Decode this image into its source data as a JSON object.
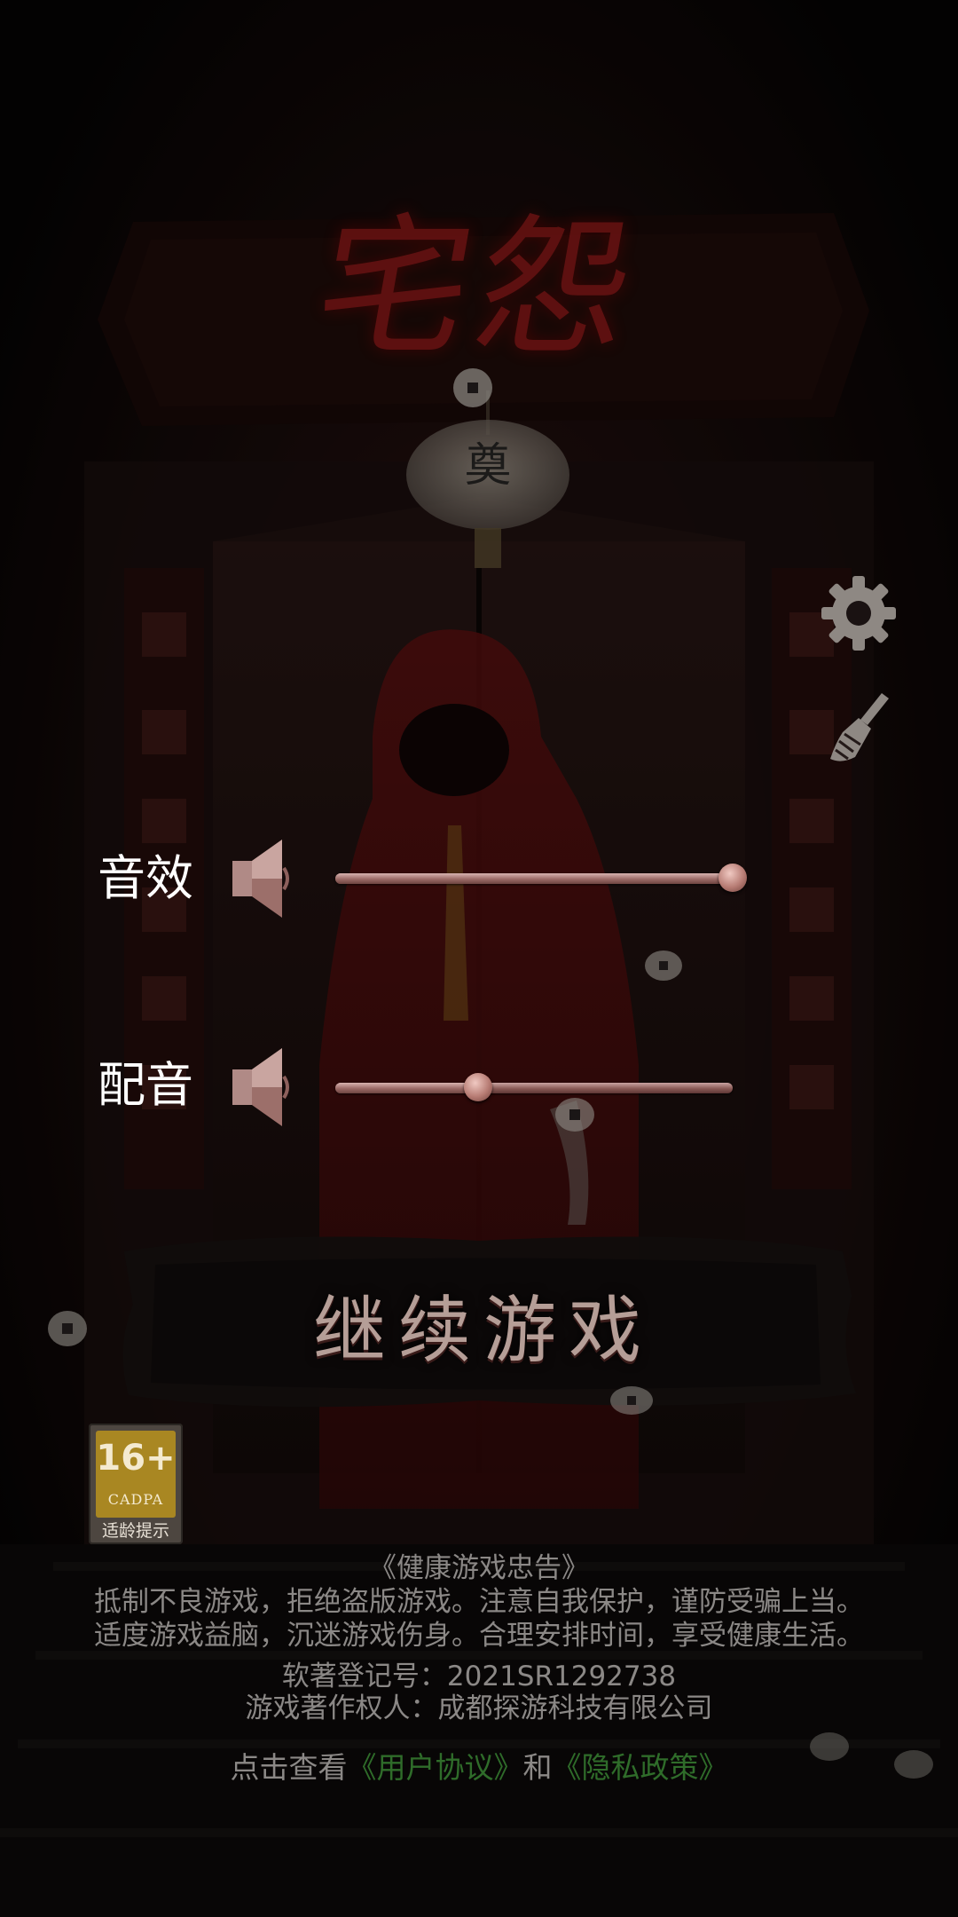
{
  "game": {
    "title_logo": "宅怨",
    "lantern_char": "奠"
  },
  "toolbar": {
    "settings_icon": "gear-icon",
    "clean_icon": "broom-icon"
  },
  "audio": {
    "sound_effects": {
      "label": "音效",
      "icon": "speaker-icon",
      "level_percent": 100
    },
    "voice": {
      "label": "配音",
      "icon": "speaker-icon",
      "level_percent": 36
    }
  },
  "continue_button": {
    "label": "继续游戏"
  },
  "age_rating": {
    "age": "16+",
    "org": "CADPA",
    "hint": "适龄提示",
    "color": "#a98722"
  },
  "health_notice": {
    "title": "《健康游戏忠告》",
    "line1": "抵制不良游戏，拒绝盗版游戏。注意自我保护，谨防受骗上当。",
    "line2": "适度游戏益脑，沉迷游戏伤身。合理安排时间，享受健康生活。"
  },
  "copyright": {
    "registration": "软著登记号：2021SR1292738",
    "owner": "游戏著作权人：成都探游科技有限公司"
  },
  "agreement": {
    "prefix": "点击查看",
    "user_agreement": "《用户协议》",
    "conjunction": "和",
    "privacy_policy": "《隐私政策》",
    "link_color": "#2f6c2a"
  },
  "colors": {
    "background": "#0b0707",
    "blood_red": "#7a1414",
    "notice_text": "#8b8886"
  }
}
